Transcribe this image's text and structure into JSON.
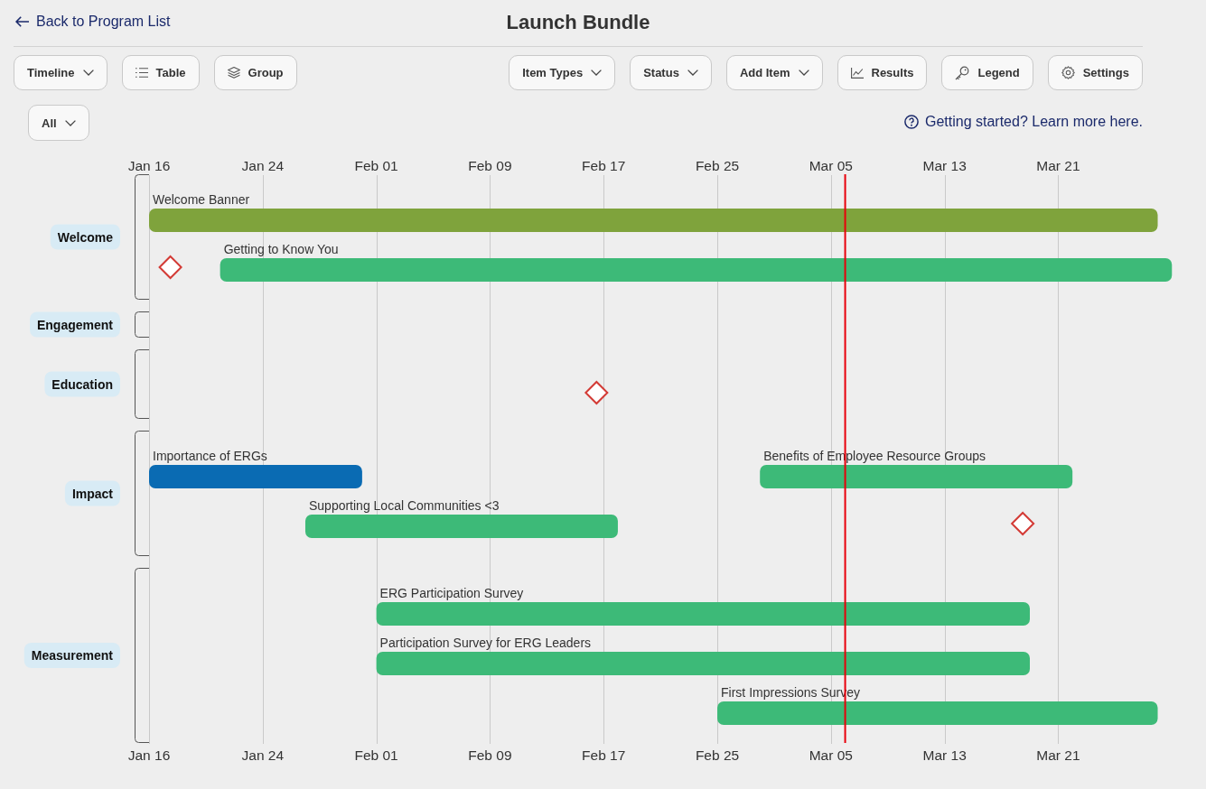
{
  "header": {
    "back_link": "Back to Program List",
    "title": "Launch Bundle"
  },
  "toolbar": {
    "left": [
      {
        "label": "Timeline",
        "kind": "dropdown"
      },
      {
        "label": "Table",
        "kind": "icon"
      },
      {
        "label": "Group",
        "kind": "icon"
      }
    ],
    "right": [
      {
        "label": "Item Types",
        "kind": "dropdown"
      },
      {
        "label": "Status",
        "kind": "dropdown"
      },
      {
        "label": "Add Item",
        "kind": "dropdown"
      },
      {
        "label": "Results",
        "kind": "icon"
      },
      {
        "label": "Legend",
        "kind": "icon"
      },
      {
        "label": "Settings",
        "kind": "icon"
      }
    ]
  },
  "filter": {
    "label": "All"
  },
  "help_link": "Getting started? Learn more here.",
  "timeline": {
    "ticks_top": [
      "Jan 16",
      "Jan 24",
      "Feb 01",
      "Feb 09",
      "Feb 17",
      "Feb 25",
      "Mar 05",
      "Mar 13",
      "Mar 21"
    ],
    "groups": [
      {
        "label": "Welcome",
        "rows": [
          {
            "items": [
              {
                "kind": "bar",
                "title": "Welcome Banner",
                "color": "#7fa33c"
              }
            ]
          },
          {
            "items": [
              {
                "kind": "milestone"
              },
              {
                "kind": "bar",
                "title": "Getting to Know You",
                "color": "#3dba78"
              }
            ]
          }
        ]
      },
      {
        "label": "Engagement"
      },
      {
        "label": "Education",
        "rows": [
          {
            "items": [
              {
                "kind": "milestone"
              }
            ]
          }
        ]
      },
      {
        "label": "Impact",
        "rows": [
          {
            "items": [
              {
                "kind": "bar",
                "title": "Importance of ERGs",
                "color": "#0a6bb3"
              },
              {
                "kind": "bar",
                "title": "Benefits of Employee Resource Groups",
                "color": "#3dba78"
              }
            ]
          },
          {
            "items": [
              {
                "kind": "bar",
                "title": "Supporting Local Communities <3",
                "color": "#3dba78"
              },
              {
                "kind": "milestone"
              }
            ]
          }
        ]
      },
      {
        "label": "Measurement",
        "rows": [
          {
            "items": [
              {
                "kind": "bar",
                "title": "ERG Participation Survey",
                "color": "#3dba78"
              }
            ]
          },
          {
            "items": [
              {
                "kind": "bar",
                "title": "Participation Survey for ERG Leaders",
                "color": "#3dba78"
              }
            ]
          },
          {
            "items": [
              {
                "kind": "bar",
                "title": "First Impressions Survey",
                "color": "#3dba78"
              }
            ]
          }
        ]
      }
    ],
    "ticks_bottom": [
      "Jan 16",
      "Jan 24",
      "Feb 01",
      "Feb 09",
      "Feb 17",
      "Feb 25",
      "Mar 05",
      "Mar 13",
      "Mar 21"
    ]
  }
}
